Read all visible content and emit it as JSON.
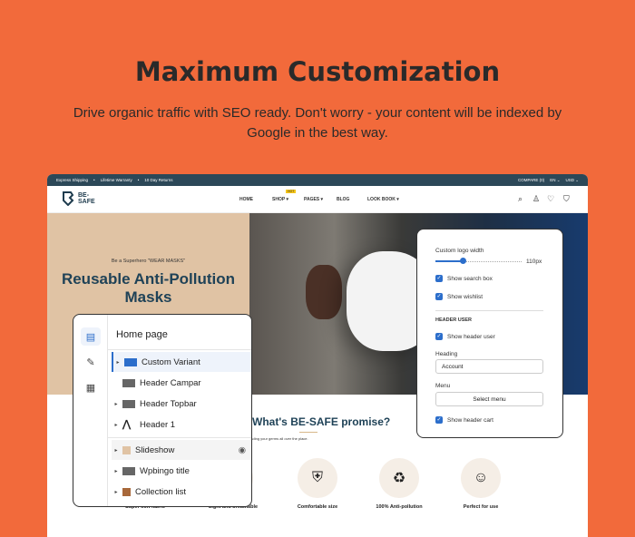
{
  "title": "Maximum Customization",
  "subtitle": "Drive organic traffic with SEO ready.  Don't worry - your content will be indexed by Google in the best way.",
  "colors": {
    "background": "#f26a3b",
    "topbar": "#2c4858",
    "accent": "#2c6ecb",
    "hero": "#e0c3a4"
  },
  "store": {
    "topbar_left": [
      "Express Shipping",
      "•",
      "Lifetime Warranty",
      "•",
      "10 Day Returns"
    ],
    "topbar_right": [
      "COMPARE (0)",
      "EN ⌄",
      "USD ⌄"
    ],
    "logo": "BE-SAFE",
    "nav": [
      "HOME",
      "SHOP ▾",
      "PAGES ▾",
      "BLOG",
      "LOOK BOOK ▾"
    ],
    "hot_badge": "HOT",
    "tagline": "Be a Superhero \"WEAR MASKS\"",
    "hero_heading": "Reusable Anti-Pollution Masks",
    "promise_title": "What's BE-SAFE promise?",
    "promise_sub": "on your face. You big disgrace. Spreading your germs all over the place.",
    "features": [
      "Super soft fabric",
      "Light and breathable",
      "Comfortable size",
      "100% Anti-pollution",
      "Perfect for use"
    ]
  },
  "editor": {
    "heading": "Home page",
    "sections": [
      {
        "label": "Custom Variant",
        "icon": "section-icon",
        "selected": true
      },
      {
        "label": "Header Campar",
        "icon": "section-icon"
      },
      {
        "label": "Header Topbar",
        "icon": "section-icon"
      },
      {
        "label": "Header 1",
        "icon": "logo-icon"
      },
      {
        "label": "Slideshow",
        "icon": "image-icon"
      },
      {
        "label": "Wpbingo title",
        "icon": "section-icon"
      },
      {
        "label": "Collection list",
        "icon": "image-icon"
      }
    ]
  },
  "settings": {
    "logo_width_label": "Custom logo width",
    "logo_width_value": "110px",
    "logo_width_fraction": 0.35,
    "show_search": "Show search box",
    "show_wishlist": "Show wishlist",
    "header_user": "HEADER USER",
    "show_user": "Show header user",
    "heading_label": "Heading",
    "heading_value": "Account",
    "menu_label": "Menu",
    "menu_button": "Select menu",
    "show_cart": "Show header cart"
  }
}
